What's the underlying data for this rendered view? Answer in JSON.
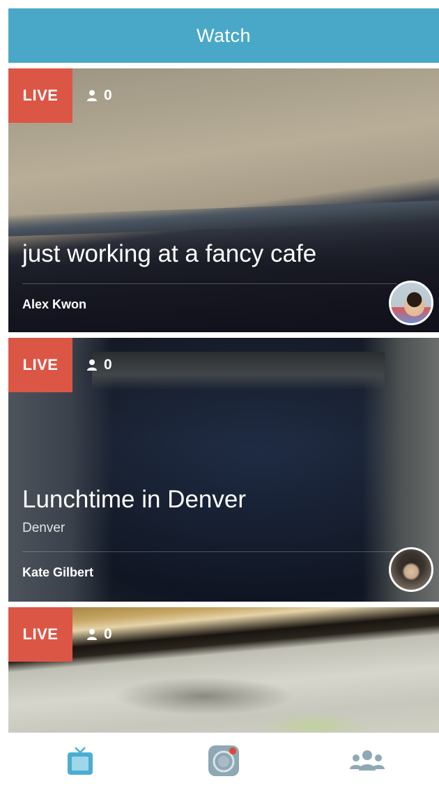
{
  "header": {
    "title": "Watch"
  },
  "streams": [
    {
      "badge": "LIVE",
      "viewers": "0",
      "title": "just working at a fancy cafe",
      "location": "",
      "author": "Alex Kwon"
    },
    {
      "badge": "LIVE",
      "viewers": "0",
      "title": "Lunchtime in Denver",
      "location": "Denver",
      "author": "Kate Gilbert"
    },
    {
      "badge": "LIVE",
      "viewers": "0"
    }
  ],
  "tabbar": {
    "items": [
      {
        "icon": "tv-icon",
        "active": true
      },
      {
        "icon": "broadcast-camera-icon",
        "active": false
      },
      {
        "icon": "people-icon",
        "active": false
      }
    ]
  },
  "colors": {
    "header": "#49a8c8",
    "live_badge": "#dc5645",
    "tab_active": "#4aaed0",
    "tab_inactive": "#8ea8b4"
  }
}
